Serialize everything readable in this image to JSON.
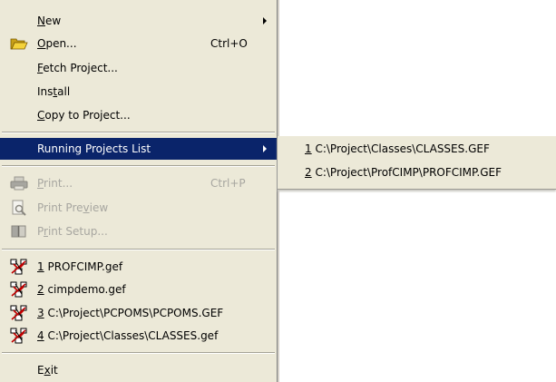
{
  "menu": {
    "new": {
      "label": "New",
      "mnemonic": "N",
      "rest": "ew"
    },
    "open": {
      "mnemonic": "O",
      "rest": "pen...",
      "shortcut": "Ctrl+O",
      "icon": "open-folder-icon"
    },
    "fetch": {
      "mnemonic": "F",
      "rest": "etch Project..."
    },
    "install": {
      "pre": "Ins",
      "mnemonic": "t",
      "rest": "all"
    },
    "copy": {
      "mnemonic": "C",
      "rest": "opy to Project..."
    },
    "running": {
      "label": "Running Projects List"
    },
    "print": {
      "mnemonic": "P",
      "rest": "rint...",
      "shortcut": "Ctrl+P",
      "icon": "printer-icon"
    },
    "preview": {
      "pre": "Print Pre",
      "mnemonic": "v",
      "rest": "iew",
      "icon": "print-preview-icon"
    },
    "setup": {
      "pre": "P",
      "mnemonic": "r",
      "rest": "int Setup...",
      "icon": "print-setup-icon"
    },
    "recent": [
      {
        "num": "1",
        "path": " PROFCIMP.gef"
      },
      {
        "num": "2",
        "path": " cimpdemo.gef"
      },
      {
        "num": "3",
        "path": " C:\\Project\\PCPOMS\\PCPOMS.GEF"
      },
      {
        "num": "4",
        "path": " C:\\Project\\Classes\\CLASSES.gef"
      }
    ],
    "exit": {
      "pre": "E",
      "mnemonic": "x",
      "rest": "it"
    }
  },
  "submenu": {
    "items": [
      {
        "num": "1",
        "path": " C:\\Project\\Classes\\CLASSES.GEF"
      },
      {
        "num": "2",
        "path": " C:\\Project\\ProfCIMP\\PROFCIMP.GEF"
      }
    ]
  },
  "colors": {
    "menu_bg": "#ece9d8",
    "highlight": "#0a246a",
    "disabled_text": "#a7a6a0"
  }
}
